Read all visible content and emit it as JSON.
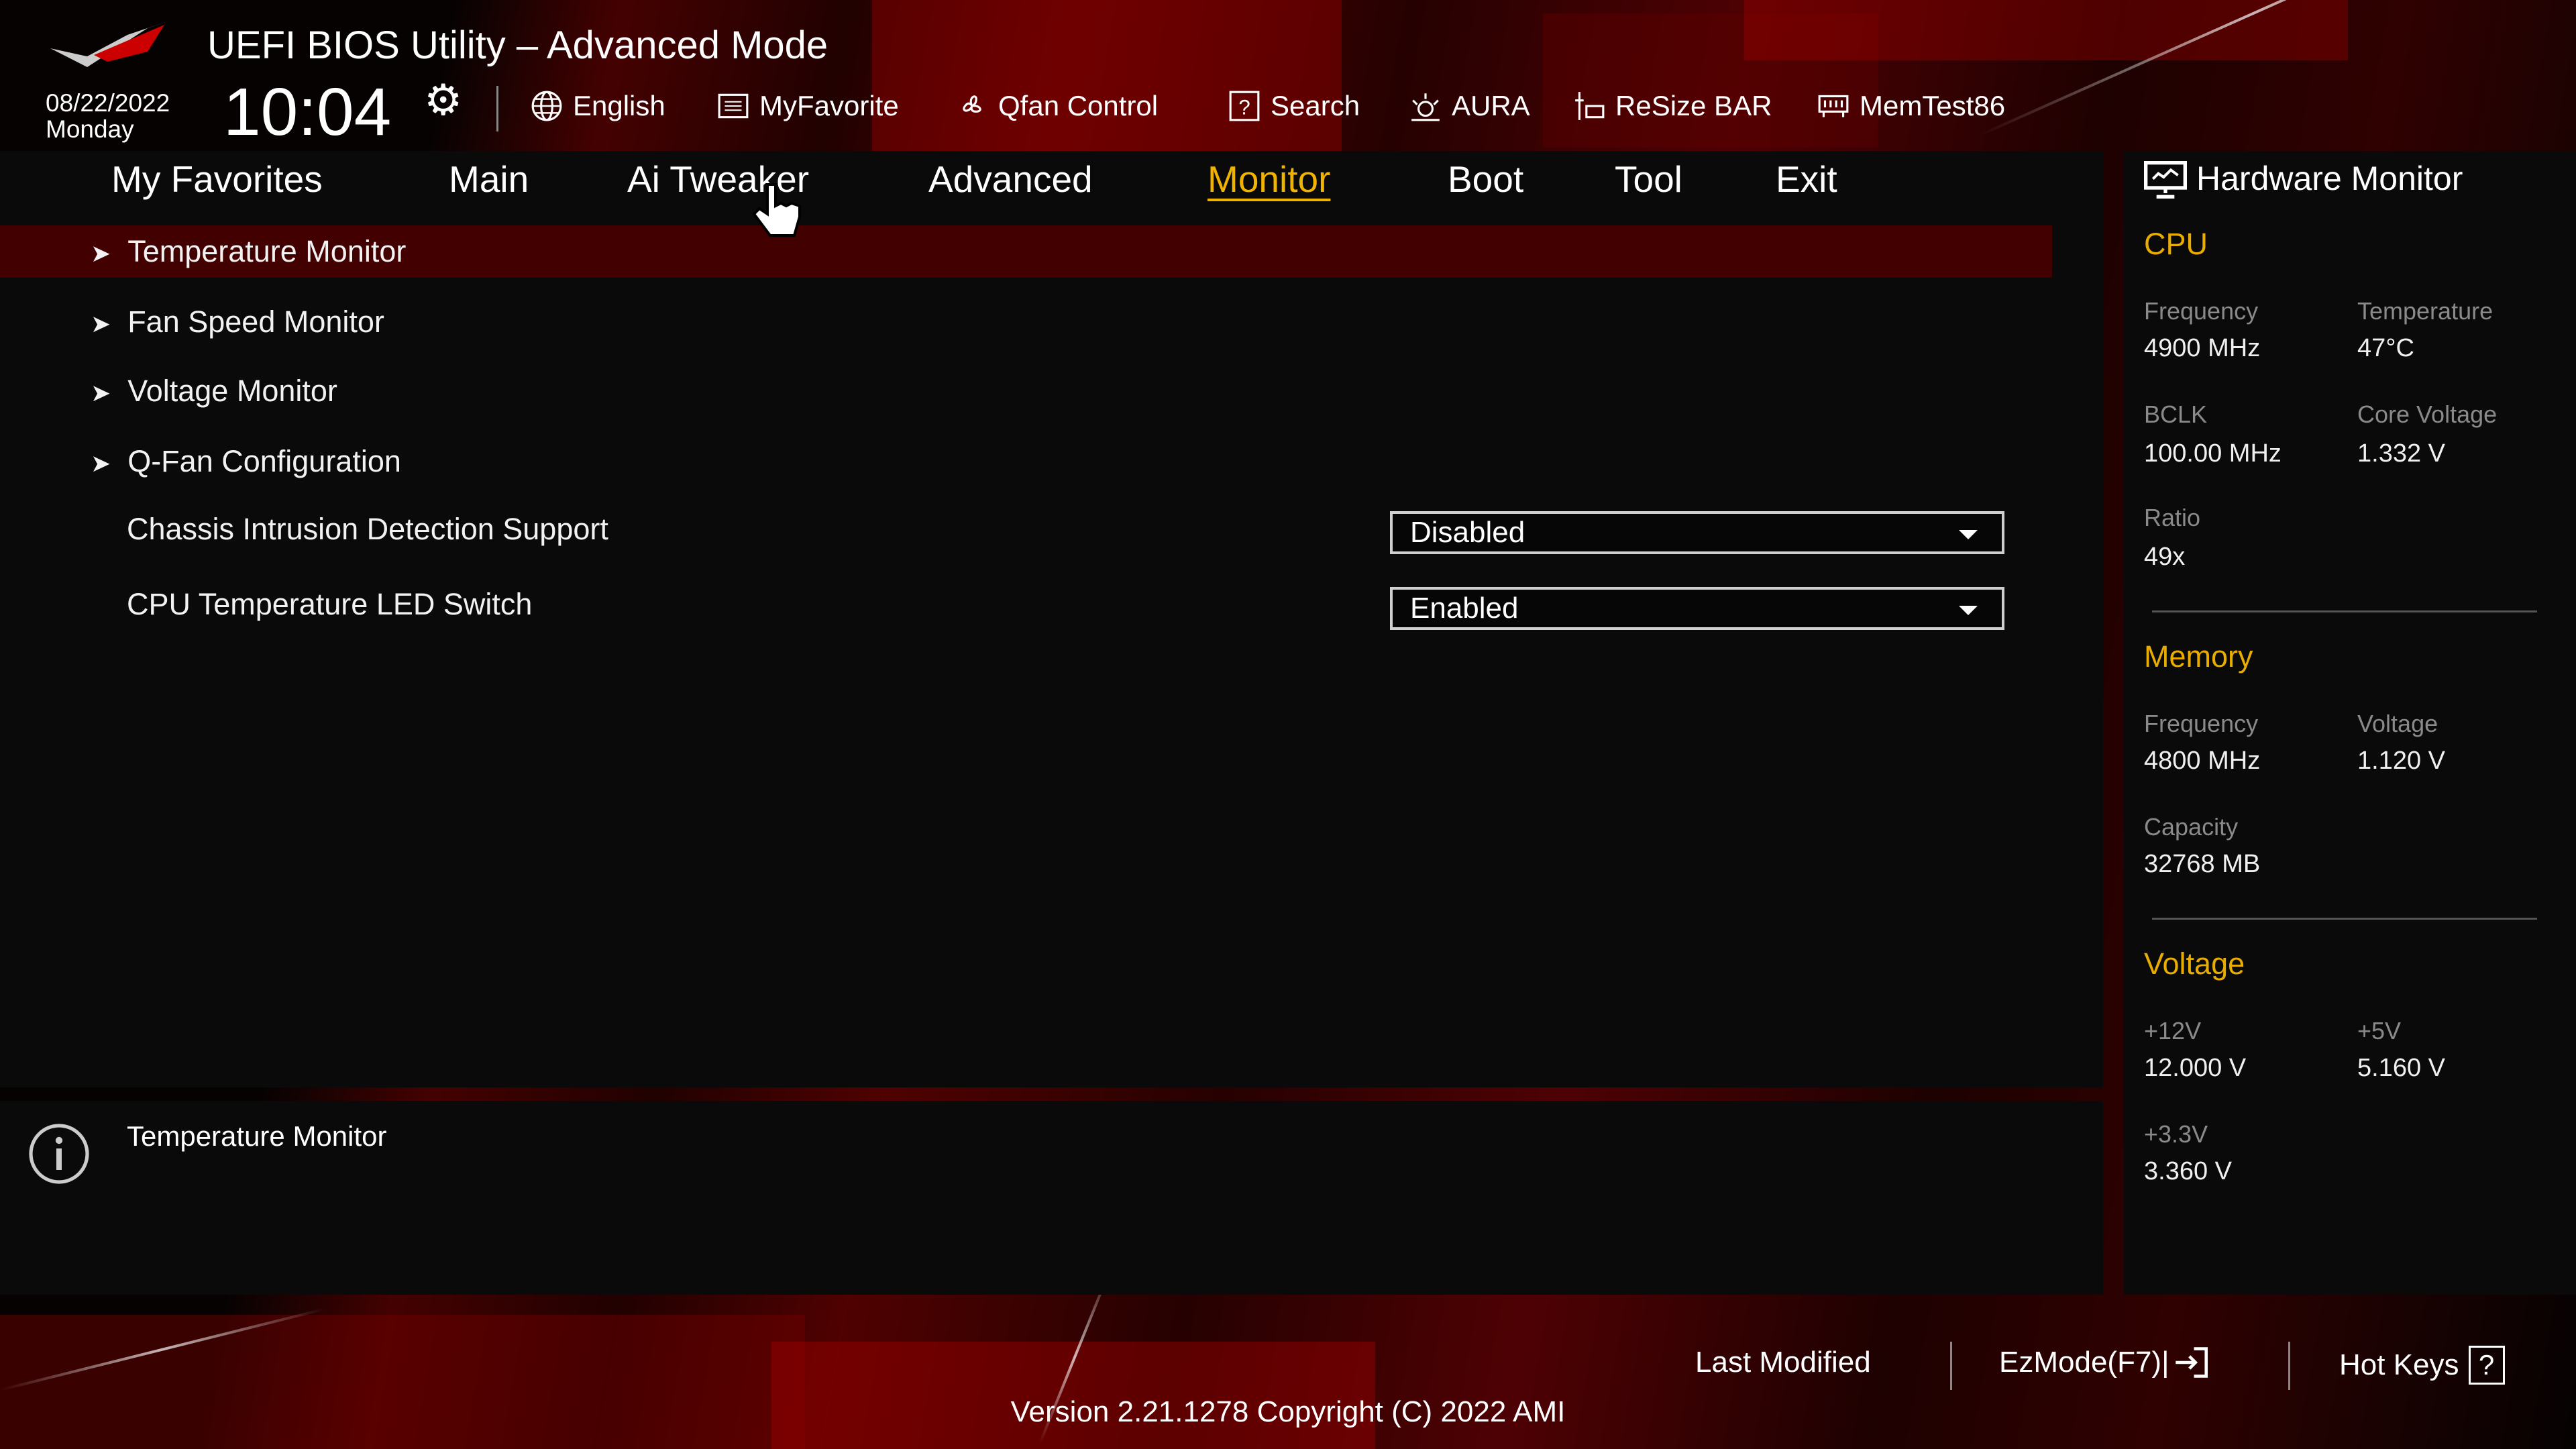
{
  "header": {
    "title": "UEFI BIOS Utility – Advanced Mode",
    "date": "08/22/2022",
    "day": "Monday",
    "time": "10:04",
    "toolbar": [
      {
        "label": "English",
        "icon": "globe-icon"
      },
      {
        "label": "MyFavorite",
        "icon": "favorite-list-icon"
      },
      {
        "label": "Qfan Control",
        "icon": "fan-icon"
      },
      {
        "label": "Search",
        "icon": "help-search-icon"
      },
      {
        "label": "AURA",
        "icon": "aura-light-icon"
      },
      {
        "label": "ReSize BAR",
        "icon": "resize-bar-icon"
      },
      {
        "label": "MemTest86",
        "icon": "memory-icon"
      }
    ]
  },
  "tabs": [
    {
      "label": "My Favorites"
    },
    {
      "label": "Main"
    },
    {
      "label": "Ai Tweaker"
    },
    {
      "label": "Advanced"
    },
    {
      "label": "Monitor",
      "active": true
    },
    {
      "label": "Boot"
    },
    {
      "label": "Tool"
    },
    {
      "label": "Exit"
    }
  ],
  "menu": {
    "submenus": [
      "Temperature Monitor",
      "Fan Speed Monitor",
      "Voltage Monitor",
      "Q-Fan Configuration"
    ],
    "settings": [
      {
        "label": "Chassis Intrusion Detection Support",
        "value": "Disabled"
      },
      {
        "label": "CPU Temperature LED Switch",
        "value": "Enabled"
      }
    ],
    "selected": "Temperature Monitor"
  },
  "info": {
    "text": "Temperature Monitor"
  },
  "hw": {
    "title": "Hardware Monitor",
    "cpu": {
      "title": "CPU",
      "freq_l": "Frequency",
      "freq": "4900 MHz",
      "temp_l": "Temperature",
      "temp": "47°C",
      "bclk_l": "BCLK",
      "bclk": "100.00 MHz",
      "cv_l": "Core Voltage",
      "cv": "1.332 V",
      "ratio_l": "Ratio",
      "ratio": "49x"
    },
    "mem": {
      "title": "Memory",
      "freq_l": "Frequency",
      "freq": "4800 MHz",
      "volt_l": "Voltage",
      "volt": "1.120 V",
      "cap_l": "Capacity",
      "cap": "32768 MB"
    },
    "volt": {
      "title": "Voltage",
      "v12_l": "+12V",
      "v12": "12.000 V",
      "v5_l": "+5V",
      "v5": "5.160 V",
      "v33_l": "+3.3V",
      "v33": "3.360 V"
    }
  },
  "footer": {
    "last_modified": "Last Modified",
    "ezmode": "EzMode(F7)|",
    "hotkeys": "Hot Keys",
    "hotkeys_icon": "?",
    "version": "Version 2.21.1278 Copyright (C) 2022 AMI"
  },
  "colors": {
    "accent": "#f0b400",
    "selected_row": "#430000",
    "section": "#e8ad00"
  }
}
